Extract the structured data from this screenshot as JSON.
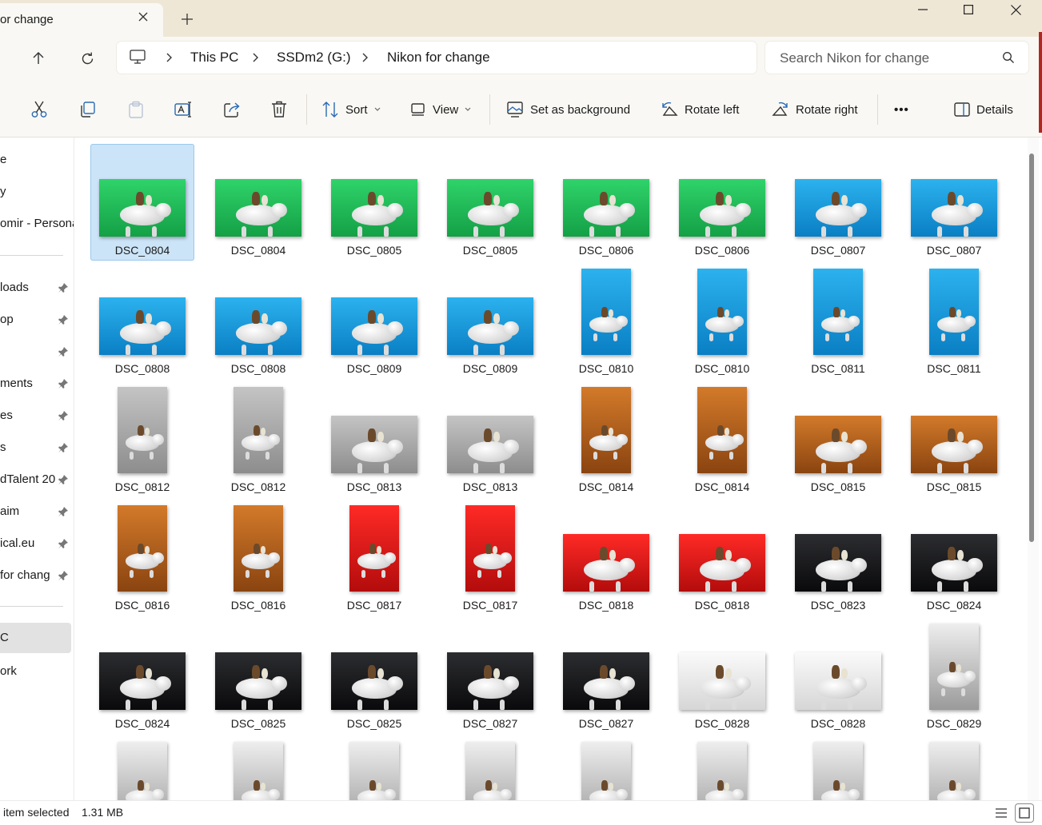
{
  "window": {
    "tab_title": "or change",
    "new_tab_label": "+",
    "minimize_icon": "minimize-icon",
    "maximize_icon": "maximize-icon",
    "close_icon": "close-icon"
  },
  "breadcrumb": [
    "This PC",
    "SSDm2 (G:)",
    "Nikon for change"
  ],
  "search": {
    "placeholder": "Search Nikon for change"
  },
  "toolbar": {
    "sort_label": "Sort",
    "view_label": "View",
    "set_background_label": "Set as background",
    "rotate_left_label": "Rotate left",
    "rotate_right_label": "Rotate right",
    "more_label": "•••",
    "details_label": "Details"
  },
  "sidebar": {
    "items": [
      {
        "label": "e",
        "pinned": false
      },
      {
        "label": "y",
        "pinned": false
      },
      {
        "label": "omir - Persona",
        "pinned": false
      },
      {
        "label": "loads",
        "pinned": true
      },
      {
        "label": "op",
        "pinned": true
      },
      {
        "label": "",
        "pinned": true
      },
      {
        "label": "ments",
        "pinned": true
      },
      {
        "label": "es",
        "pinned": true
      },
      {
        "label": "s",
        "pinned": true
      },
      {
        "label": "dTalent 20",
        "pinned": true
      },
      {
        "label": "aim",
        "pinned": true
      },
      {
        "label": "ical.eu",
        "pinned": true
      },
      {
        "label": " for chang",
        "pinned": true
      },
      {
        "label": "C",
        "pinned": false
      },
      {
        "label": "ork",
        "pinned": false
      }
    ]
  },
  "files": [
    {
      "name": "DSC_0804",
      "bg": "green",
      "orient": "land"
    },
    {
      "name": "DSC_0804",
      "bg": "green",
      "orient": "land"
    },
    {
      "name": "DSC_0805",
      "bg": "green",
      "orient": "land"
    },
    {
      "name": "DSC_0805",
      "bg": "green",
      "orient": "land"
    },
    {
      "name": "DSC_0806",
      "bg": "green",
      "orient": "land"
    },
    {
      "name": "DSC_0806",
      "bg": "green",
      "orient": "land"
    },
    {
      "name": "DSC_0807",
      "bg": "blue",
      "orient": "land"
    },
    {
      "name": "DSC_0807",
      "bg": "blue",
      "orient": "land"
    },
    {
      "name": "DSC_0808",
      "bg": "blue",
      "orient": "land"
    },
    {
      "name": "DSC_0808",
      "bg": "blue",
      "orient": "land"
    },
    {
      "name": "DSC_0809",
      "bg": "blue",
      "orient": "land"
    },
    {
      "name": "DSC_0809",
      "bg": "blue",
      "orient": "land"
    },
    {
      "name": "DSC_0810",
      "bg": "blue",
      "orient": "port"
    },
    {
      "name": "DSC_0810",
      "bg": "blue",
      "orient": "port"
    },
    {
      "name": "DSC_0811",
      "bg": "blue",
      "orient": "port"
    },
    {
      "name": "DSC_0811",
      "bg": "blue",
      "orient": "port"
    },
    {
      "name": "DSC_0812",
      "bg": "gray",
      "orient": "port"
    },
    {
      "name": "DSC_0812",
      "bg": "gray",
      "orient": "port"
    },
    {
      "name": "DSC_0813",
      "bg": "gray",
      "orient": "land"
    },
    {
      "name": "DSC_0813",
      "bg": "gray",
      "orient": "land"
    },
    {
      "name": "DSC_0814",
      "bg": "orange",
      "orient": "port"
    },
    {
      "name": "DSC_0814",
      "bg": "orange",
      "orient": "port"
    },
    {
      "name": "DSC_0815",
      "bg": "orange",
      "orient": "land"
    },
    {
      "name": "DSC_0815",
      "bg": "orange",
      "orient": "land"
    },
    {
      "name": "DSC_0816",
      "bg": "orange",
      "orient": "port"
    },
    {
      "name": "DSC_0816",
      "bg": "orange",
      "orient": "port"
    },
    {
      "name": "DSC_0817",
      "bg": "red",
      "orient": "port"
    },
    {
      "name": "DSC_0817",
      "bg": "red",
      "orient": "port"
    },
    {
      "name": "DSC_0818",
      "bg": "red",
      "orient": "land"
    },
    {
      "name": "DSC_0818",
      "bg": "red",
      "orient": "land"
    },
    {
      "name": "DSC_0823",
      "bg": "dark",
      "orient": "land"
    },
    {
      "name": "DSC_0824",
      "bg": "dark",
      "orient": "land"
    },
    {
      "name": "DSC_0824",
      "bg": "dark",
      "orient": "land"
    },
    {
      "name": "DSC_0825",
      "bg": "dark",
      "orient": "land"
    },
    {
      "name": "DSC_0825",
      "bg": "dark",
      "orient": "land"
    },
    {
      "name": "DSC_0827",
      "bg": "dark",
      "orient": "land"
    },
    {
      "name": "DSC_0827",
      "bg": "dark",
      "orient": "land"
    },
    {
      "name": "DSC_0828",
      "bg": "white",
      "orient": "land"
    },
    {
      "name": "DSC_0828",
      "bg": "white",
      "orient": "land"
    },
    {
      "name": "DSC_0829",
      "bg": "lightgray",
      "orient": "port"
    },
    {
      "name": "",
      "bg": "lightgray",
      "orient": "port"
    },
    {
      "name": "",
      "bg": "lightgray",
      "orient": "port"
    },
    {
      "name": "",
      "bg": "lightgray",
      "orient": "port"
    },
    {
      "name": "",
      "bg": "lightgray",
      "orient": "port"
    },
    {
      "name": "",
      "bg": "lightgray",
      "orient": "port"
    },
    {
      "name": "",
      "bg": "lightgray",
      "orient": "port"
    },
    {
      "name": "",
      "bg": "lightgray",
      "orient": "port"
    },
    {
      "name": "",
      "bg": "lightgray",
      "orient": "port"
    }
  ],
  "selected_index": 0,
  "colors": {
    "green": "#22c45a",
    "blue": "#1a9fe0",
    "gray": "#a9a9a9",
    "orange": "#b9621c",
    "red": "#e0191c",
    "dark": "#17181a",
    "white": "#f0f0f0",
    "lightgray": "#d8d8d8",
    "selection": "#cce4f7",
    "accent": "#0067c0"
  },
  "status": {
    "selected_text": "item selected",
    "size_text": "1.31 MB",
    "details_view_icon": "details-view-icon",
    "large_icons_view_icon": "large-icons-view-icon"
  }
}
